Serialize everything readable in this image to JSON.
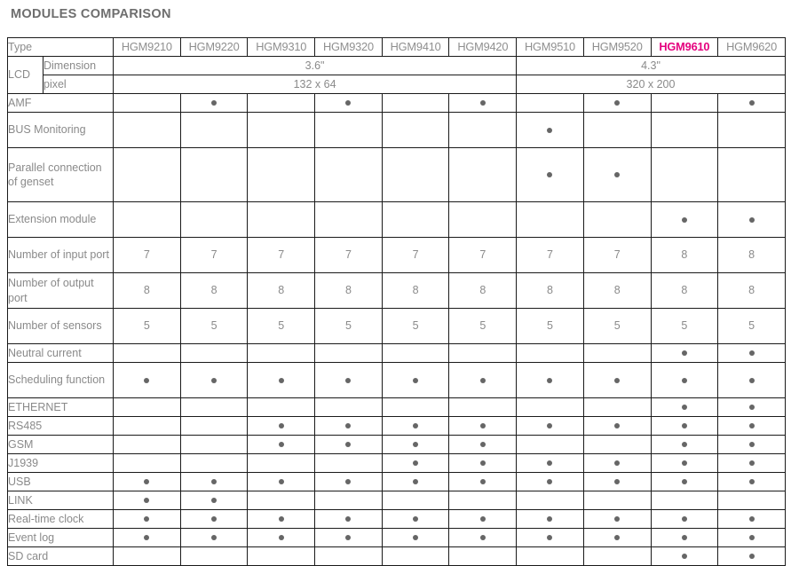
{
  "page": {
    "title": "MODULES COMPARISON"
  },
  "colors": {
    "text": "#8a8a8a",
    "title": "#6e6e6e",
    "highlight": "#e5007e",
    "dot": "#666666",
    "border": "#1a1a1a"
  },
  "table": {
    "type_header_label": "Type",
    "lcd_group_label": "LCD",
    "lcd_rows": [
      {
        "sublabel": "Dimension",
        "groups": [
          {
            "value": "3.6\"",
            "span": 6
          },
          {
            "value": "4.3\"",
            "span": 4
          }
        ]
      },
      {
        "sublabel": "pixel",
        "groups": [
          {
            "value": "132 x 64",
            "span": 6
          },
          {
            "value": "320 x 200",
            "span": 4
          }
        ]
      }
    ],
    "models": [
      {
        "name": "HGM9210",
        "highlight": false
      },
      {
        "name": "HGM9220",
        "highlight": false
      },
      {
        "name": "HGM9310",
        "highlight": false
      },
      {
        "name": "HGM9320",
        "highlight": false
      },
      {
        "name": "HGM9410",
        "highlight": false
      },
      {
        "name": "HGM9420",
        "highlight": false
      },
      {
        "name": "HGM9510",
        "highlight": false
      },
      {
        "name": "HGM9520",
        "highlight": false
      },
      {
        "name": "HGM9610",
        "highlight": true
      },
      {
        "name": "HGM9620",
        "highlight": false
      }
    ],
    "dot_glyph": "●",
    "rows": [
      {
        "label": "AMF",
        "lines": 1,
        "values": [
          "",
          "●",
          "",
          "●",
          "",
          "●",
          "",
          "●",
          "",
          "●"
        ]
      },
      {
        "label": "BUS Monitoring",
        "lines": 2,
        "values": [
          "",
          "",
          "",
          "",
          "",
          "",
          "●",
          "",
          "",
          ""
        ]
      },
      {
        "label": "Parallel connection of genset",
        "lines": 3,
        "values": [
          "",
          "",
          "",
          "",
          "",
          "",
          "●",
          "●",
          "",
          ""
        ]
      },
      {
        "label": "Extension module",
        "lines": 2,
        "values": [
          "",
          "",
          "",
          "",
          "",
          "",
          "",
          "",
          "●",
          "●"
        ]
      },
      {
        "label": "Number of input port",
        "lines": 2,
        "values": [
          "7",
          "7",
          "7",
          "7",
          "7",
          "7",
          "7",
          "7",
          "8",
          "8"
        ]
      },
      {
        "label": "Number of output port",
        "lines": 2,
        "values": [
          "8",
          "8",
          "8",
          "8",
          "8",
          "8",
          "8",
          "8",
          "8",
          "8"
        ]
      },
      {
        "label": "Number of sensors",
        "lines": 2,
        "values": [
          "5",
          "5",
          "5",
          "5",
          "5",
          "5",
          "5",
          "5",
          "5",
          "5"
        ]
      },
      {
        "label": "Neutral current",
        "lines": 1,
        "values": [
          "",
          "",
          "",
          "",
          "",
          "",
          "",
          "",
          "●",
          "●"
        ]
      },
      {
        "label": "Scheduling function",
        "lines": 2,
        "values": [
          "●",
          "●",
          "●",
          "●",
          "●",
          "●",
          "●",
          "●",
          "●",
          "●"
        ]
      },
      {
        "label": "ETHERNET",
        "lines": 1,
        "values": [
          "",
          "",
          "",
          "",
          "",
          "",
          "",
          "",
          "●",
          "●"
        ]
      },
      {
        "label": "RS485",
        "lines": 1,
        "values": [
          "",
          "",
          "●",
          "●",
          "●",
          "●",
          "●",
          "●",
          "●",
          "●"
        ]
      },
      {
        "label": "GSM",
        "lines": 1,
        "values": [
          "",
          "",
          "●",
          "●",
          "●",
          "●",
          "",
          "",
          "●",
          "●"
        ]
      },
      {
        "label": "J1939",
        "lines": 1,
        "values": [
          "",
          "",
          "",
          "",
          "●",
          "●",
          "●",
          "●",
          "●",
          "●"
        ]
      },
      {
        "label": "USB",
        "lines": 1,
        "values": [
          "●",
          "●",
          "●",
          "●",
          "●",
          "●",
          "●",
          "●",
          "●",
          "●"
        ]
      },
      {
        "label": "LINK",
        "lines": 1,
        "values": [
          "●",
          "●",
          "",
          "",
          "",
          "",
          "",
          "",
          "",
          ""
        ]
      },
      {
        "label": "Real-time clock",
        "lines": 1,
        "values": [
          "●",
          "●",
          "●",
          "●",
          "●",
          "●",
          "●",
          "●",
          "●",
          "●"
        ]
      },
      {
        "label": "Event log",
        "lines": 1,
        "values": [
          "●",
          "●",
          "●",
          "●",
          "●",
          "●",
          "●",
          "●",
          "●",
          "●"
        ]
      },
      {
        "label": "SD card",
        "lines": 1,
        "values": [
          "",
          "",
          "",
          "",
          "",
          "",
          "",
          "",
          "●",
          "●"
        ]
      }
    ]
  }
}
